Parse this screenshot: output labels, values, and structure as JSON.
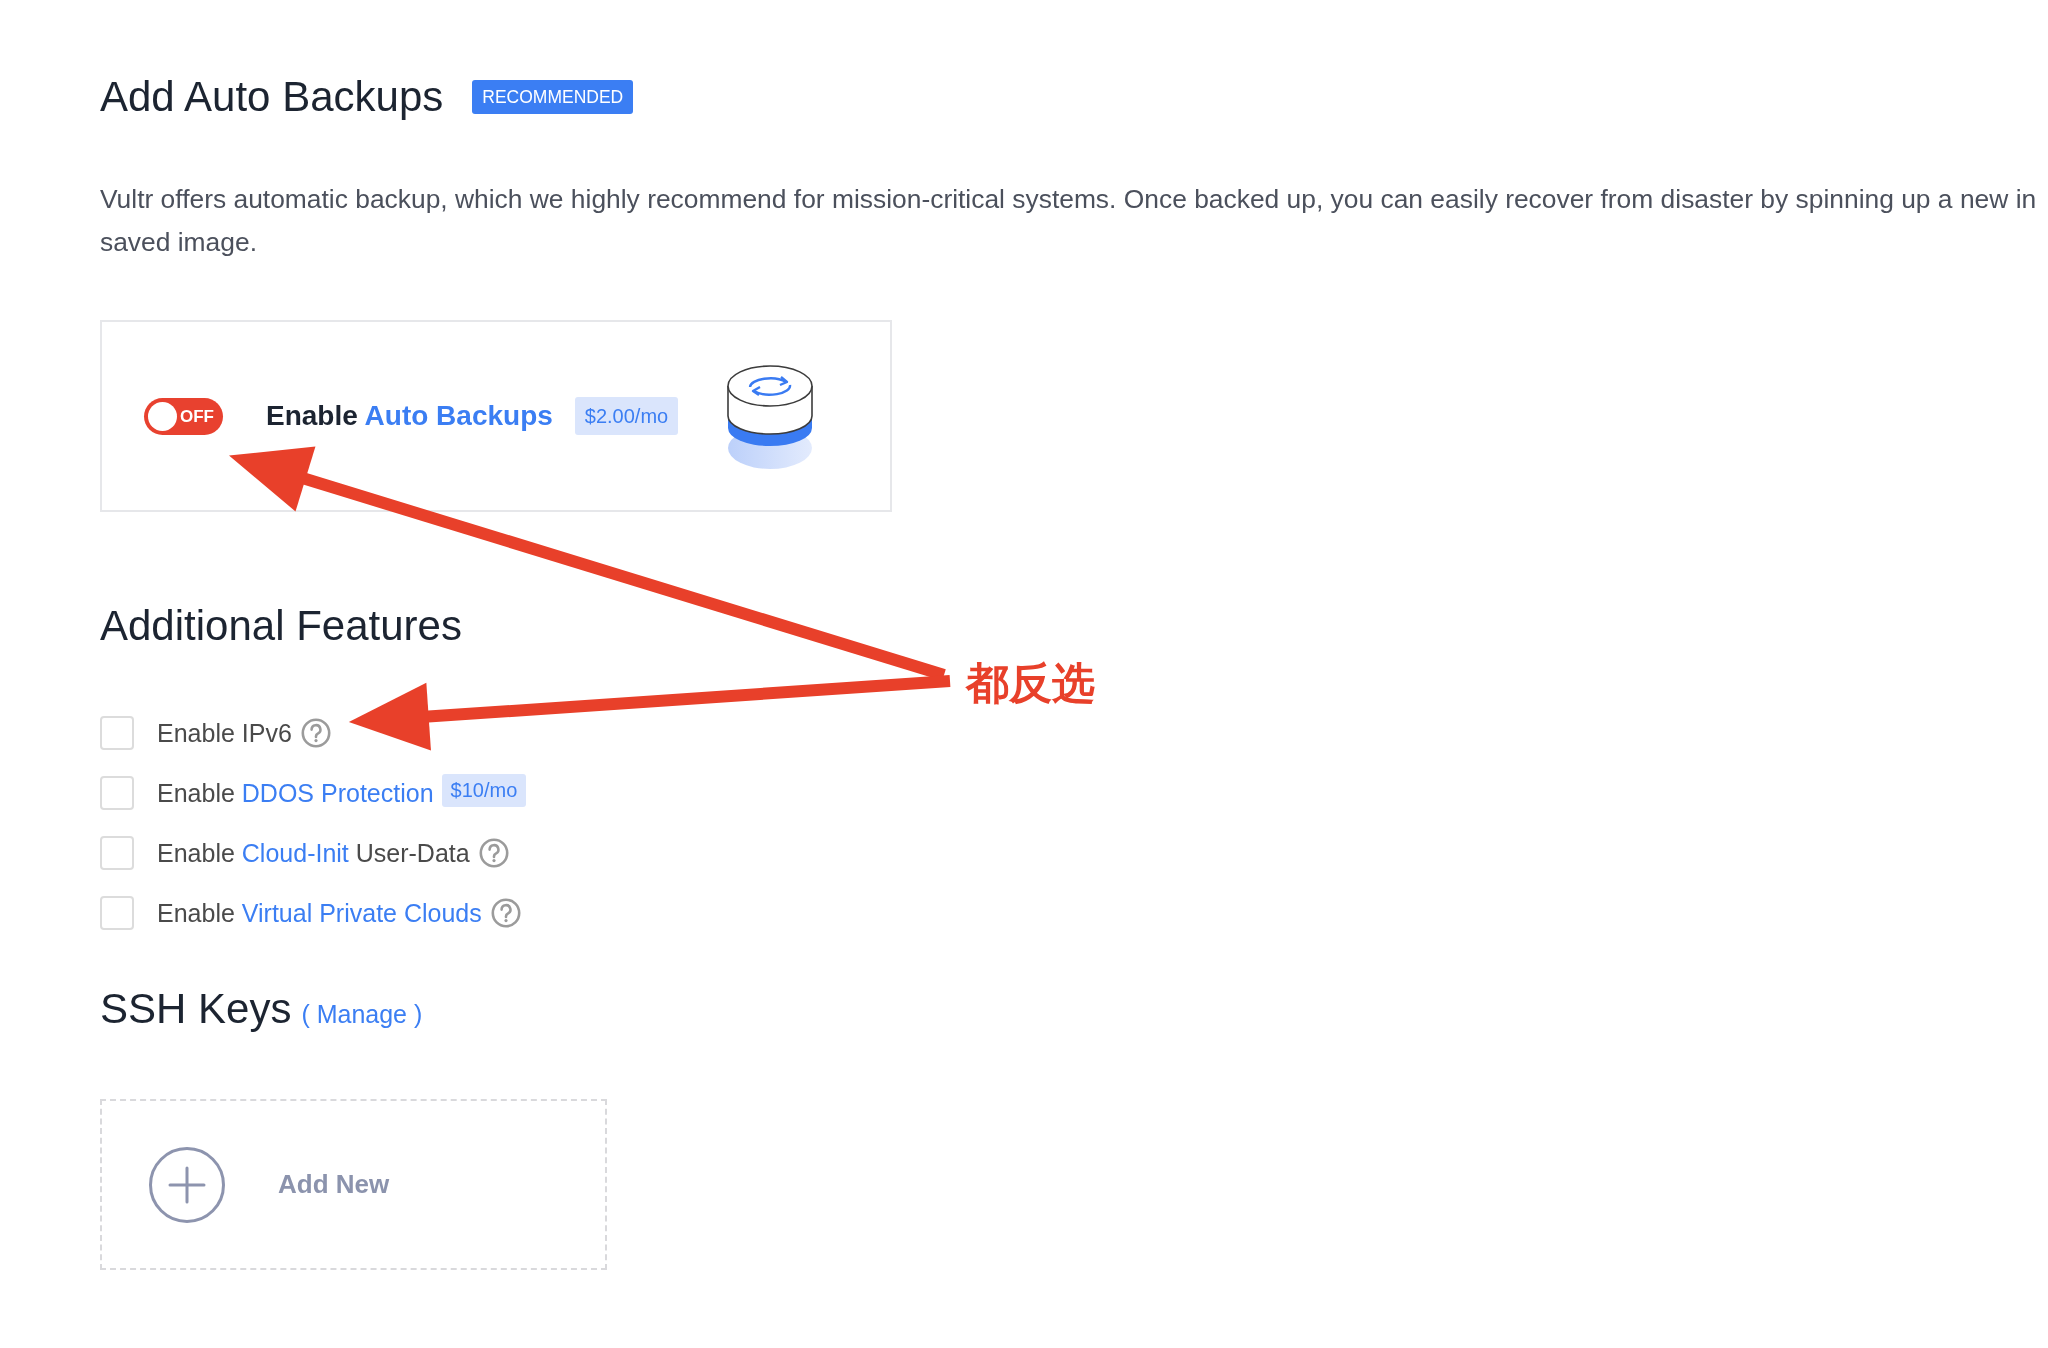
{
  "backups": {
    "title": "Add Auto Backups",
    "badge": "RECOMMENDED",
    "description": [
      "Vultr offers automatic backup, which we highly recommend for mission-critical systems. Once backed up, you can easily recover from disaster by spinning up a new in",
      "saved image."
    ],
    "toggle": {
      "on": false,
      "label": "OFF"
    },
    "option": {
      "label": [
        {
          "kind": "text",
          "text": "Enable"
        },
        {
          "kind": "link",
          "text": "Auto Backups"
        }
      ],
      "price": "$2.00/mo"
    }
  },
  "additional_features": {
    "title": "Additional Features",
    "items": [
      {
        "checked": false,
        "label": [
          {
            "kind": "text",
            "text": "Enable IPv6"
          }
        ],
        "help": true
      },
      {
        "checked": false,
        "label": [
          {
            "kind": "text",
            "text": "Enable"
          },
          {
            "kind": "link",
            "text": "DDOS Protection"
          }
        ],
        "price": "$10/mo",
        "help": false
      },
      {
        "checked": false,
        "label": [
          {
            "kind": "text",
            "text": "Enable"
          },
          {
            "kind": "link",
            "text": "Cloud-Init"
          },
          {
            "kind": "text",
            "text": "User-Data"
          }
        ],
        "help": true
      },
      {
        "checked": false,
        "label": [
          {
            "kind": "text",
            "text": "Enable"
          },
          {
            "kind": "link",
            "text": "Virtual Private Clouds"
          }
        ],
        "help": true
      }
    ]
  },
  "ssh_keys": {
    "title": "SSH Keys",
    "manage_link": "( Manage )",
    "add_button": "Add New"
  },
  "annotation": {
    "text": "都反选"
  }
}
